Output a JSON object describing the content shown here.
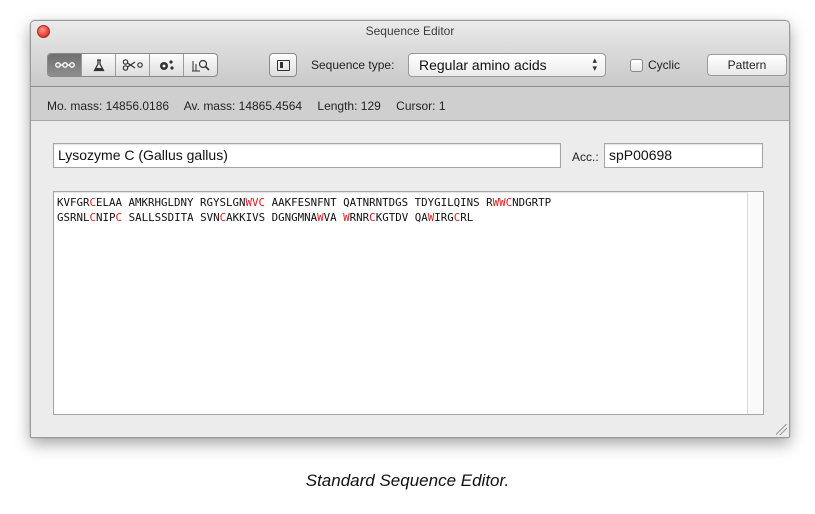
{
  "window": {
    "title": "Sequence Editor"
  },
  "toolbar": {
    "segmented_icons": [
      "sequence-view-icon",
      "flask-icon",
      "scissors-icon",
      "molecule-icon",
      "search-magnifier-icon"
    ],
    "sequence_type_label": "Sequence type:",
    "sequence_type_value": "Regular amino acids",
    "cyclic_label": "Cyclic",
    "cyclic_checked": false,
    "pattern_label": "Pattern"
  },
  "status": {
    "mo_mass": "Mo. mass: 14856.0186",
    "av_mass": "Av. mass: 14865.4564",
    "length": "Length: 129",
    "cursor": "Cursor: 1"
  },
  "fields": {
    "name": "Lysozyme C (Gallus gallus)",
    "acc_label": "Acc.:",
    "acc_value": "spP00698"
  },
  "sequence": {
    "highlight_color": "#e01a1a",
    "lines": [
      [
        {
          "t": "KVFGR"
        },
        {
          "t": "C",
          "hl": true
        },
        {
          "t": "ELAA AMKRHGLDNY RGYSLGN"
        },
        {
          "t": "WVC",
          "hl": true
        },
        {
          "t": " AAKFESNFNT QATNRNTDGS TDYGILQINS R"
        },
        {
          "t": "WWC",
          "hl": true
        },
        {
          "t": "NDGRTP"
        }
      ],
      [
        {
          "t": "GSRNL"
        },
        {
          "t": "C",
          "hl": true
        },
        {
          "t": "NIP"
        },
        {
          "t": "C",
          "hl": true
        },
        {
          "t": " SALLSSDITA SVN"
        },
        {
          "t": "C",
          "hl": true
        },
        {
          "t": "AKKIVS DGNGMNA"
        },
        {
          "t": "W",
          "hl": true
        },
        {
          "t": "VA "
        },
        {
          "t": "W",
          "hl": true
        },
        {
          "t": "RNR"
        },
        {
          "t": "C",
          "hl": true
        },
        {
          "t": "KGTDV QA"
        },
        {
          "t": "W",
          "hl": true
        },
        {
          "t": "IRG"
        },
        {
          "t": "C",
          "hl": true
        },
        {
          "t": "RL"
        }
      ]
    ]
  },
  "caption": "Standard Sequence Editor."
}
